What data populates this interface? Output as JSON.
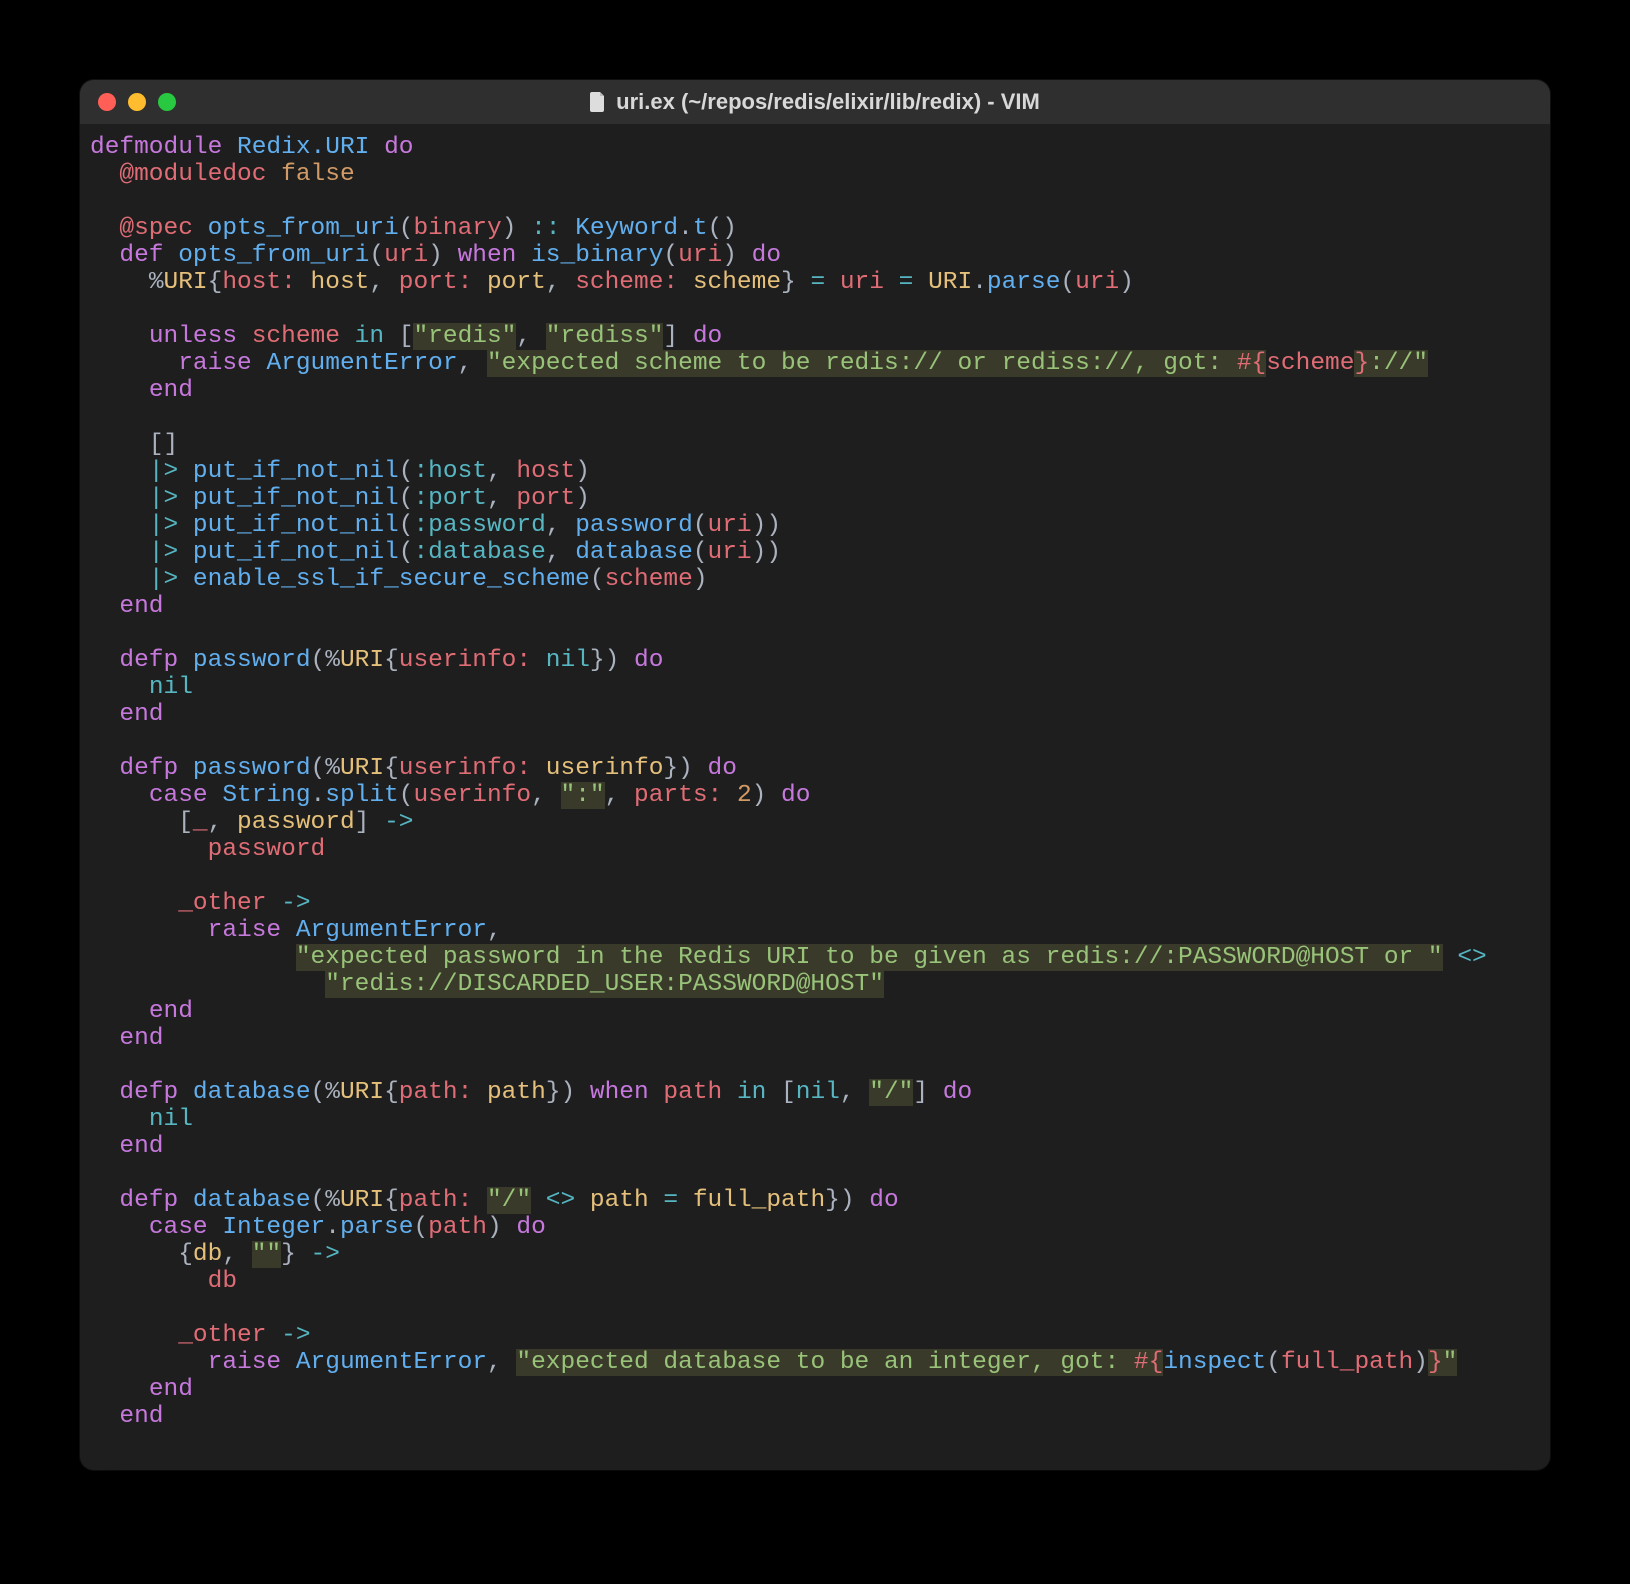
{
  "window": {
    "title": "uri.ex (~/repos/redis/elixir/lib/redix) - VIM",
    "filename": "uri.ex"
  },
  "code": {
    "lines": [
      [
        [
          "kw",
          "defmodule"
        ],
        [
          "white",
          " "
        ],
        [
          "mod",
          "Redix.URI"
        ],
        [
          "white",
          " "
        ],
        [
          "kw",
          "do"
        ]
      ],
      [
        [
          "white",
          "  "
        ],
        [
          "attr",
          "@moduledoc"
        ],
        [
          "white",
          " "
        ],
        [
          "bool",
          "false"
        ]
      ],
      [
        [
          "white",
          ""
        ]
      ],
      [
        [
          "white",
          "  "
        ],
        [
          "attr",
          "@spec"
        ],
        [
          "white",
          " "
        ],
        [
          "fndef",
          "opts_from_uri"
        ],
        [
          "pun",
          "("
        ],
        [
          "var",
          "binary"
        ],
        [
          "pun",
          ")"
        ],
        [
          "white",
          " "
        ],
        [
          "op",
          "::"
        ],
        [
          "white",
          " "
        ],
        [
          "mod",
          "Keyword"
        ],
        [
          "pun",
          "."
        ],
        [
          "fn",
          "t"
        ],
        [
          "pun",
          "()"
        ]
      ],
      [
        [
          "white",
          "  "
        ],
        [
          "kw",
          "def"
        ],
        [
          "white",
          " "
        ],
        [
          "fndef",
          "opts_from_uri"
        ],
        [
          "pun",
          "("
        ],
        [
          "var",
          "uri"
        ],
        [
          "pun",
          ")"
        ],
        [
          "white",
          " "
        ],
        [
          "kw",
          "when"
        ],
        [
          "white",
          " "
        ],
        [
          "fn",
          "is_binary"
        ],
        [
          "pun",
          "("
        ],
        [
          "var",
          "uri"
        ],
        [
          "pun",
          ")"
        ],
        [
          "white",
          " "
        ],
        [
          "kw",
          "do"
        ]
      ],
      [
        [
          "white",
          "    "
        ],
        [
          "pun",
          "%"
        ],
        [
          "typ",
          "URI"
        ],
        [
          "pun",
          "{"
        ],
        [
          "key",
          "host:"
        ],
        [
          "white",
          " "
        ],
        [
          "varm",
          "host"
        ],
        [
          "pun",
          ", "
        ],
        [
          "key",
          "port:"
        ],
        [
          "white",
          " "
        ],
        [
          "varm",
          "port"
        ],
        [
          "pun",
          ", "
        ],
        [
          "key",
          "scheme:"
        ],
        [
          "white",
          " "
        ],
        [
          "varm",
          "scheme"
        ],
        [
          "pun",
          "}"
        ],
        [
          "white",
          " "
        ],
        [
          "op",
          "="
        ],
        [
          "white",
          " "
        ],
        [
          "var",
          "uri"
        ],
        [
          "white",
          " "
        ],
        [
          "op",
          "="
        ],
        [
          "white",
          " "
        ],
        [
          "typ",
          "URI"
        ],
        [
          "pun",
          "."
        ],
        [
          "fn",
          "parse"
        ],
        [
          "pun",
          "("
        ],
        [
          "var",
          "uri"
        ],
        [
          "pun",
          ")"
        ]
      ],
      [
        [
          "white",
          ""
        ]
      ],
      [
        [
          "white",
          "    "
        ],
        [
          "kw",
          "unless"
        ],
        [
          "white",
          " "
        ],
        [
          "var",
          "scheme"
        ],
        [
          "white",
          " "
        ],
        [
          "op",
          "in"
        ],
        [
          "white",
          " "
        ],
        [
          "pun",
          "["
        ],
        [
          "strbg",
          "\"redis\""
        ],
        [
          "pun",
          ", "
        ],
        [
          "strbg",
          "\"rediss\""
        ],
        [
          "pun",
          "]"
        ],
        [
          "white",
          " "
        ],
        [
          "kw",
          "do"
        ]
      ],
      [
        [
          "white",
          "      "
        ],
        [
          "kw",
          "raise"
        ],
        [
          "white",
          " "
        ],
        [
          "mod",
          "ArgumentError"
        ],
        [
          "pun",
          ", "
        ],
        [
          "strbg",
          "\"expected scheme to be redis:// or rediss://, got: "
        ],
        [
          "interp",
          "#{"
        ],
        [
          "var",
          "scheme"
        ],
        [
          "interp",
          "}"
        ],
        [
          "strbg",
          "://\""
        ]
      ],
      [
        [
          "white",
          "    "
        ],
        [
          "kw",
          "end"
        ]
      ],
      [
        [
          "white",
          ""
        ]
      ],
      [
        [
          "white",
          "    "
        ],
        [
          "pun",
          "[]"
        ]
      ],
      [
        [
          "white",
          "    "
        ],
        [
          "op",
          "|>"
        ],
        [
          "white",
          " "
        ],
        [
          "fn",
          "put_if_not_nil"
        ],
        [
          "pun",
          "("
        ],
        [
          "atom",
          ":host"
        ],
        [
          "pun",
          ", "
        ],
        [
          "var",
          "host"
        ],
        [
          "pun",
          ")"
        ]
      ],
      [
        [
          "white",
          "    "
        ],
        [
          "op",
          "|>"
        ],
        [
          "white",
          " "
        ],
        [
          "fn",
          "put_if_not_nil"
        ],
        [
          "pun",
          "("
        ],
        [
          "atom",
          ":port"
        ],
        [
          "pun",
          ", "
        ],
        [
          "var",
          "port"
        ],
        [
          "pun",
          ")"
        ]
      ],
      [
        [
          "white",
          "    "
        ],
        [
          "op",
          "|>"
        ],
        [
          "white",
          " "
        ],
        [
          "fn",
          "put_if_not_nil"
        ],
        [
          "pun",
          "("
        ],
        [
          "atom",
          ":password"
        ],
        [
          "pun",
          ", "
        ],
        [
          "fn",
          "password"
        ],
        [
          "pun",
          "("
        ],
        [
          "var",
          "uri"
        ],
        [
          "pun",
          "))"
        ]
      ],
      [
        [
          "white",
          "    "
        ],
        [
          "op",
          "|>"
        ],
        [
          "white",
          " "
        ],
        [
          "fn",
          "put_if_not_nil"
        ],
        [
          "pun",
          "("
        ],
        [
          "atom",
          ":database"
        ],
        [
          "pun",
          ", "
        ],
        [
          "fn",
          "database"
        ],
        [
          "pun",
          "("
        ],
        [
          "var",
          "uri"
        ],
        [
          "pun",
          "))"
        ]
      ],
      [
        [
          "white",
          "    "
        ],
        [
          "op",
          "|>"
        ],
        [
          "white",
          " "
        ],
        [
          "fn",
          "enable_ssl_if_secure_scheme"
        ],
        [
          "pun",
          "("
        ],
        [
          "var",
          "scheme"
        ],
        [
          "pun",
          ")"
        ]
      ],
      [
        [
          "white",
          "  "
        ],
        [
          "kw",
          "end"
        ]
      ],
      [
        [
          "white",
          ""
        ]
      ],
      [
        [
          "white",
          "  "
        ],
        [
          "kw",
          "defp"
        ],
        [
          "white",
          " "
        ],
        [
          "fndef",
          "password"
        ],
        [
          "pun",
          "(%"
        ],
        [
          "typ",
          "URI"
        ],
        [
          "pun",
          "{"
        ],
        [
          "key",
          "userinfo:"
        ],
        [
          "white",
          " "
        ],
        [
          "atom",
          "nil"
        ],
        [
          "pun",
          "})"
        ],
        [
          "white",
          " "
        ],
        [
          "kw",
          "do"
        ]
      ],
      [
        [
          "white",
          "    "
        ],
        [
          "atom",
          "nil"
        ]
      ],
      [
        [
          "white",
          "  "
        ],
        [
          "kw",
          "end"
        ]
      ],
      [
        [
          "white",
          ""
        ]
      ],
      [
        [
          "white",
          "  "
        ],
        [
          "kw",
          "defp"
        ],
        [
          "white",
          " "
        ],
        [
          "fndef",
          "password"
        ],
        [
          "pun",
          "(%"
        ],
        [
          "typ",
          "URI"
        ],
        [
          "pun",
          "{"
        ],
        [
          "key",
          "userinfo:"
        ],
        [
          "white",
          " "
        ],
        [
          "varm",
          "userinfo"
        ],
        [
          "pun",
          "})"
        ],
        [
          "white",
          " "
        ],
        [
          "kw",
          "do"
        ]
      ],
      [
        [
          "white",
          "    "
        ],
        [
          "kw",
          "case"
        ],
        [
          "white",
          " "
        ],
        [
          "mod",
          "String"
        ],
        [
          "pun",
          "."
        ],
        [
          "fn",
          "split"
        ],
        [
          "pun",
          "("
        ],
        [
          "var",
          "userinfo"
        ],
        [
          "pun",
          ", "
        ],
        [
          "strbg",
          "\":\""
        ],
        [
          "pun",
          ", "
        ],
        [
          "key",
          "parts:"
        ],
        [
          "white",
          " "
        ],
        [
          "num",
          "2"
        ],
        [
          "pun",
          ")"
        ],
        [
          "white",
          " "
        ],
        [
          "kw",
          "do"
        ]
      ],
      [
        [
          "white",
          "      "
        ],
        [
          "pun",
          "["
        ],
        [
          "var",
          "_"
        ],
        [
          "pun",
          ", "
        ],
        [
          "varm",
          "password"
        ],
        [
          "pun",
          "]"
        ],
        [
          "white",
          " "
        ],
        [
          "op",
          "->"
        ]
      ],
      [
        [
          "white",
          "        "
        ],
        [
          "var",
          "password"
        ]
      ],
      [
        [
          "white",
          ""
        ]
      ],
      [
        [
          "white",
          "      "
        ],
        [
          "var",
          "_other"
        ],
        [
          "white",
          " "
        ],
        [
          "op",
          "->"
        ]
      ],
      [
        [
          "white",
          "        "
        ],
        [
          "kw",
          "raise"
        ],
        [
          "white",
          " "
        ],
        [
          "mod",
          "ArgumentError"
        ],
        [
          "pun",
          ","
        ]
      ],
      [
        [
          "white",
          "              "
        ],
        [
          "strbg",
          "\"expected password in the Redis URI to be given as redis://:PASSWORD@HOST or \""
        ],
        [
          "white",
          " "
        ],
        [
          "op",
          "<>"
        ]
      ],
      [
        [
          "white",
          "                "
        ],
        [
          "strbg",
          "\"redis://DISCARDED_USER:PASSWORD@HOST\""
        ]
      ],
      [
        [
          "white",
          "    "
        ],
        [
          "kw",
          "end"
        ]
      ],
      [
        [
          "white",
          "  "
        ],
        [
          "kw",
          "end"
        ]
      ],
      [
        [
          "white",
          ""
        ]
      ],
      [
        [
          "white",
          "  "
        ],
        [
          "kw",
          "defp"
        ],
        [
          "white",
          " "
        ],
        [
          "fndef",
          "database"
        ],
        [
          "pun",
          "(%"
        ],
        [
          "typ",
          "URI"
        ],
        [
          "pun",
          "{"
        ],
        [
          "key",
          "path:"
        ],
        [
          "white",
          " "
        ],
        [
          "varm",
          "path"
        ],
        [
          "pun",
          "})"
        ],
        [
          "white",
          " "
        ],
        [
          "kw",
          "when"
        ],
        [
          "white",
          " "
        ],
        [
          "var",
          "path"
        ],
        [
          "white",
          " "
        ],
        [
          "op",
          "in"
        ],
        [
          "white",
          " "
        ],
        [
          "pun",
          "["
        ],
        [
          "atom",
          "nil"
        ],
        [
          "pun",
          ", "
        ],
        [
          "strbg",
          "\"/\""
        ],
        [
          "pun",
          "]"
        ],
        [
          "white",
          " "
        ],
        [
          "kw",
          "do"
        ]
      ],
      [
        [
          "white",
          "    "
        ],
        [
          "atom",
          "nil"
        ]
      ],
      [
        [
          "white",
          "  "
        ],
        [
          "kw",
          "end"
        ]
      ],
      [
        [
          "white",
          ""
        ]
      ],
      [
        [
          "white",
          "  "
        ],
        [
          "kw",
          "defp"
        ],
        [
          "white",
          " "
        ],
        [
          "fndef",
          "database"
        ],
        [
          "pun",
          "(%"
        ],
        [
          "typ",
          "URI"
        ],
        [
          "pun",
          "{"
        ],
        [
          "key",
          "path:"
        ],
        [
          "white",
          " "
        ],
        [
          "strbg",
          "\"/\""
        ],
        [
          "white",
          " "
        ],
        [
          "op",
          "<>"
        ],
        [
          "white",
          " "
        ],
        [
          "varm",
          "path"
        ],
        [
          "white",
          " "
        ],
        [
          "op",
          "="
        ],
        [
          "white",
          " "
        ],
        [
          "varm",
          "full_path"
        ],
        [
          "pun",
          "})"
        ],
        [
          "white",
          " "
        ],
        [
          "kw",
          "do"
        ]
      ],
      [
        [
          "white",
          "    "
        ],
        [
          "kw",
          "case"
        ],
        [
          "white",
          " "
        ],
        [
          "mod",
          "Integer"
        ],
        [
          "pun",
          "."
        ],
        [
          "fn",
          "parse"
        ],
        [
          "pun",
          "("
        ],
        [
          "var",
          "path"
        ],
        [
          "pun",
          ")"
        ],
        [
          "white",
          " "
        ],
        [
          "kw",
          "do"
        ]
      ],
      [
        [
          "white",
          "      "
        ],
        [
          "pun",
          "{"
        ],
        [
          "varm",
          "db"
        ],
        [
          "pun",
          ", "
        ],
        [
          "strbg",
          "\"\""
        ],
        [
          "pun",
          "}"
        ],
        [
          "white",
          " "
        ],
        [
          "op",
          "->"
        ]
      ],
      [
        [
          "white",
          "        "
        ],
        [
          "var",
          "db"
        ]
      ],
      [
        [
          "white",
          ""
        ]
      ],
      [
        [
          "white",
          "      "
        ],
        [
          "var",
          "_other"
        ],
        [
          "white",
          " "
        ],
        [
          "op",
          "->"
        ]
      ],
      [
        [
          "white",
          "        "
        ],
        [
          "kw",
          "raise"
        ],
        [
          "white",
          " "
        ],
        [
          "mod",
          "ArgumentError"
        ],
        [
          "pun",
          ", "
        ],
        [
          "strbg",
          "\"expected database to be an integer, got: "
        ],
        [
          "interp",
          "#{"
        ],
        [
          "fn",
          "inspect"
        ],
        [
          "pun",
          "("
        ],
        [
          "var",
          "full_path"
        ],
        [
          "pun",
          ")"
        ],
        [
          "interp",
          "}"
        ],
        [
          "strbg",
          "\""
        ]
      ],
      [
        [
          "white",
          "    "
        ],
        [
          "kw",
          "end"
        ]
      ],
      [
        [
          "white",
          "  "
        ],
        [
          "kw",
          "end"
        ]
      ]
    ]
  }
}
